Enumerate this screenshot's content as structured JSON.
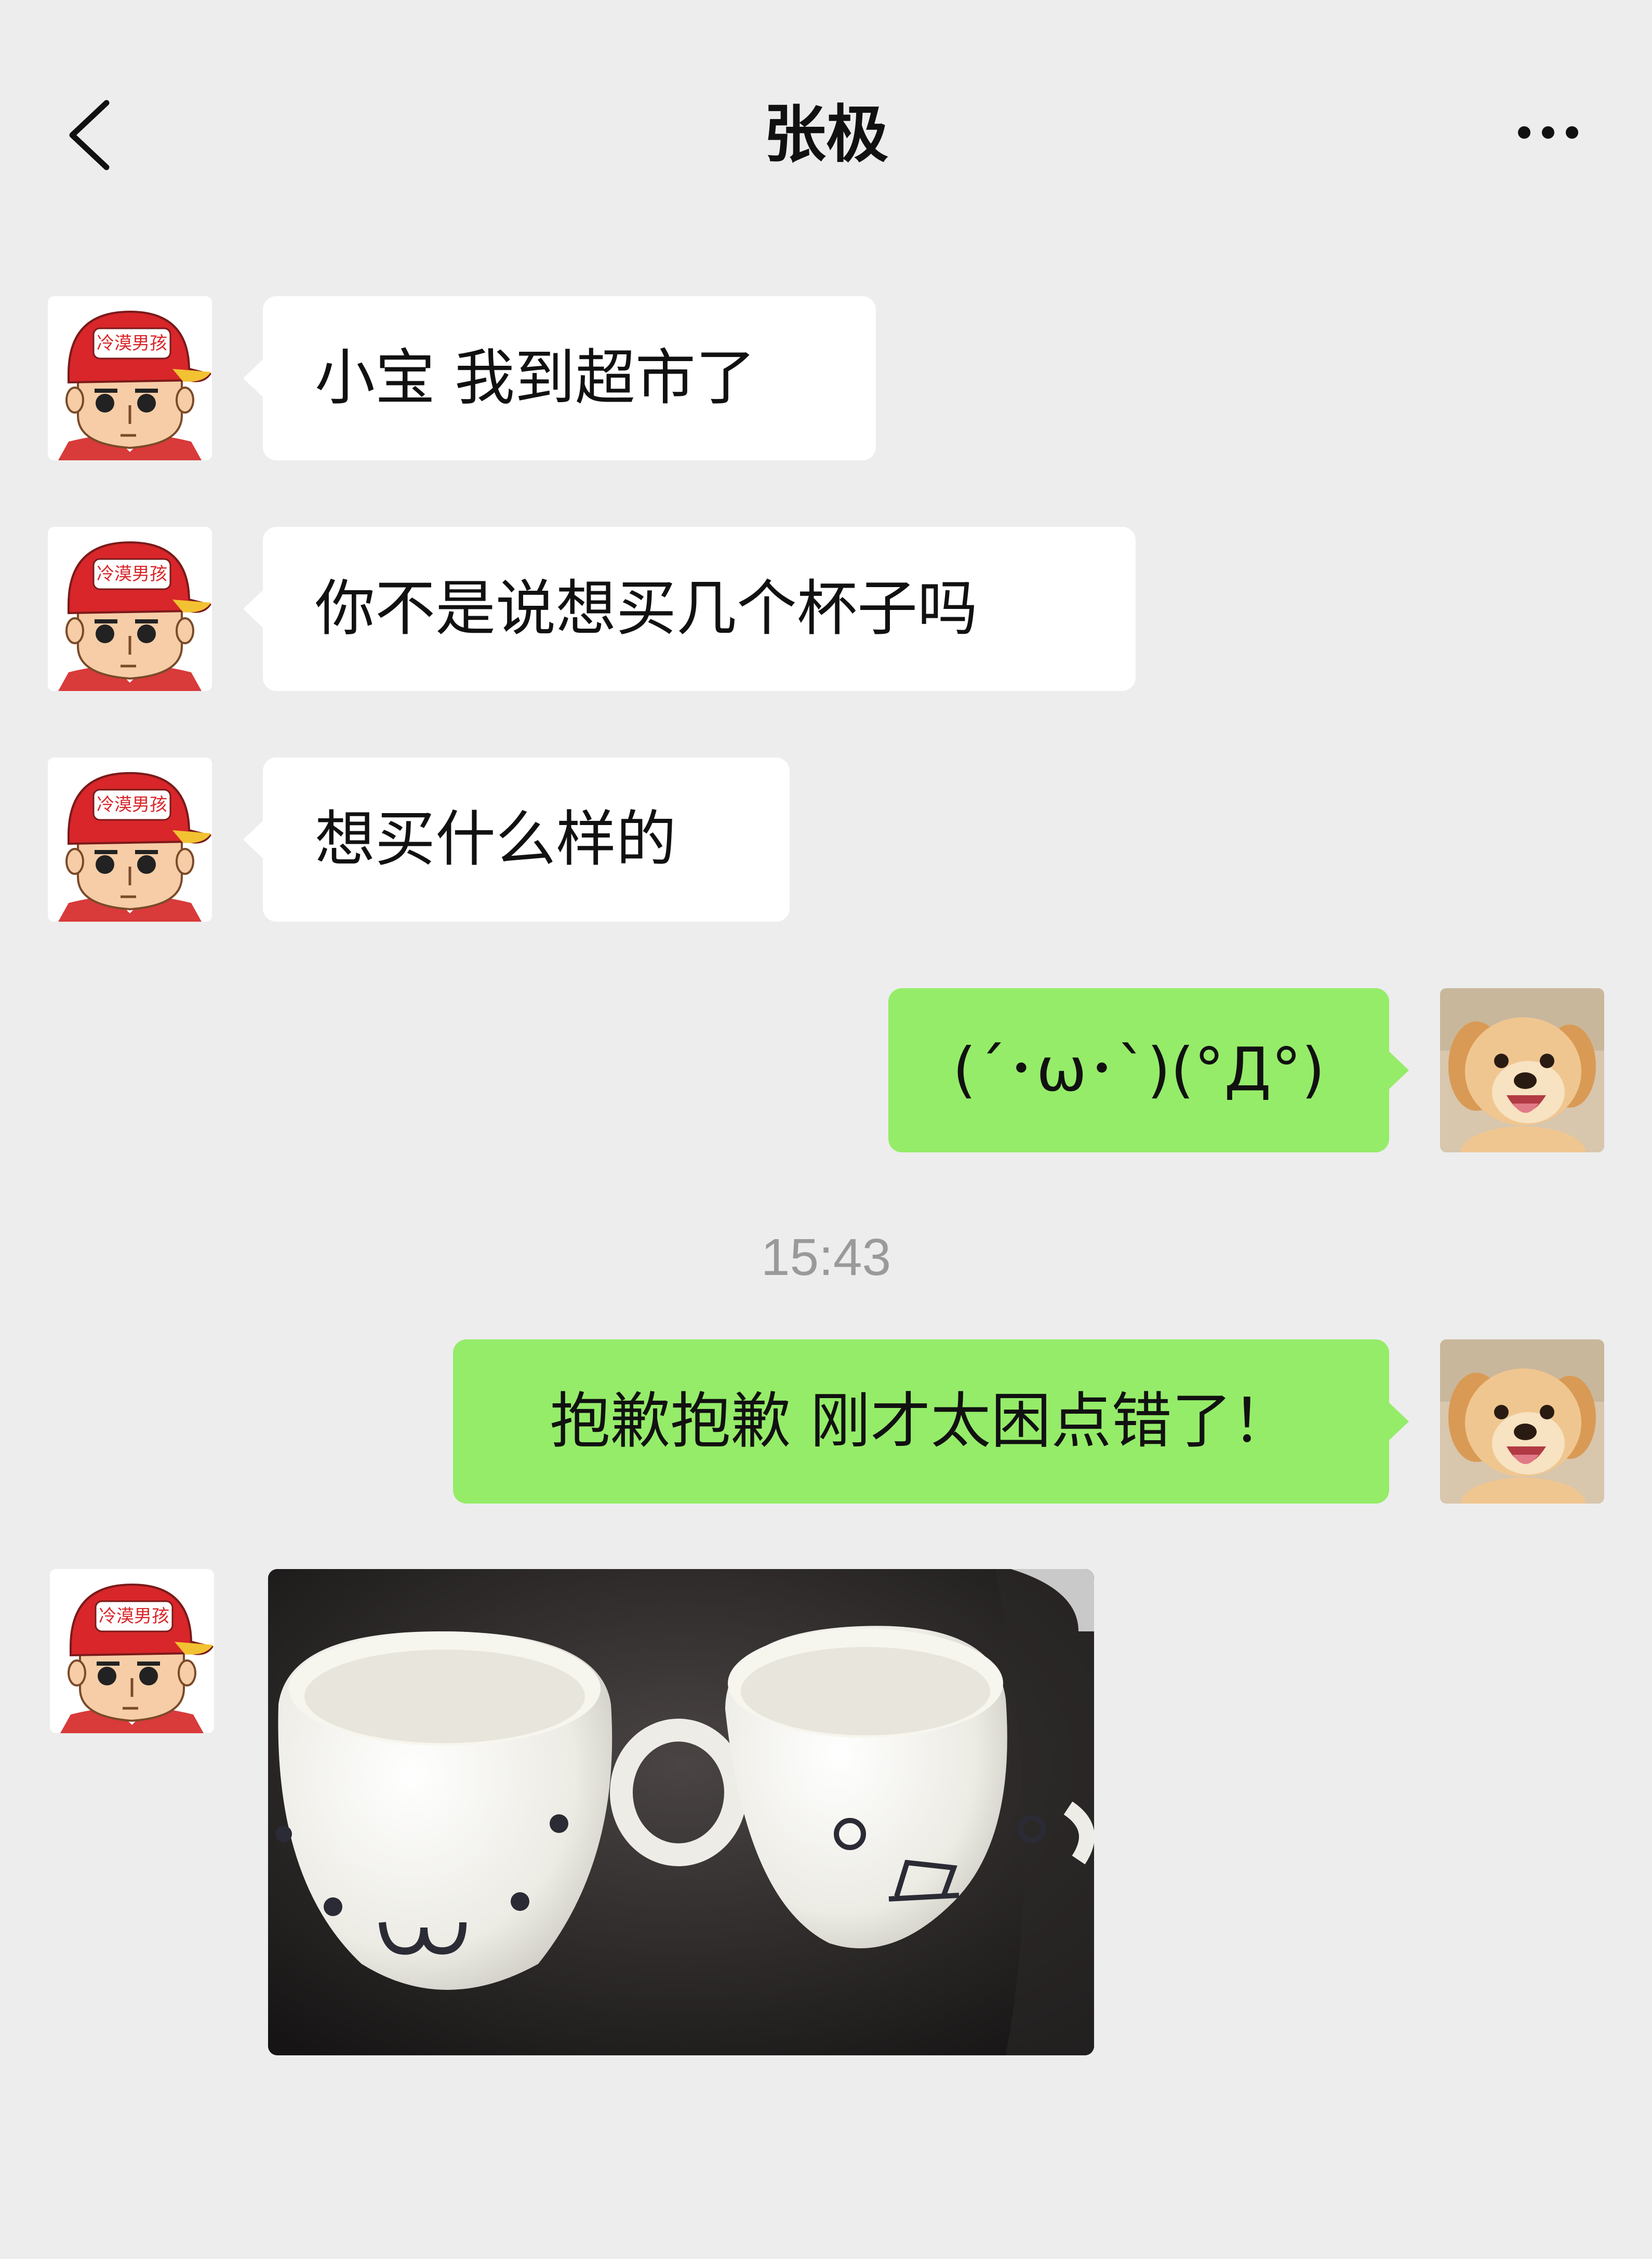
{
  "header": {
    "title": "张极",
    "back_icon": "chevron-left-icon",
    "more_icon": "more-dots-icon"
  },
  "colors": {
    "background": "#EDEDED",
    "incoming_bubble": "#FFFFFF",
    "outgoing_bubble": "#95EC69",
    "timestamp": "#9A9A9A"
  },
  "contact": {
    "avatar_badge_text": "冷漠男孩"
  },
  "messages": [
    {
      "from": "contact",
      "type": "text",
      "text": "小宝 我到超市了"
    },
    {
      "from": "contact",
      "type": "text",
      "text": "你不是说想买几个杯子吗"
    },
    {
      "from": "contact",
      "type": "text",
      "text": "想买什么样的"
    },
    {
      "from": "me",
      "type": "text",
      "text": "(´･ω･`)(°Д°)"
    },
    {
      "from": "me",
      "type": "text",
      "text": "抱歉抱歉 刚才太困点错了！"
    },
    {
      "from": "contact",
      "type": "image",
      "image": "two-cups-photo"
    }
  ],
  "timestamp": "15:43"
}
